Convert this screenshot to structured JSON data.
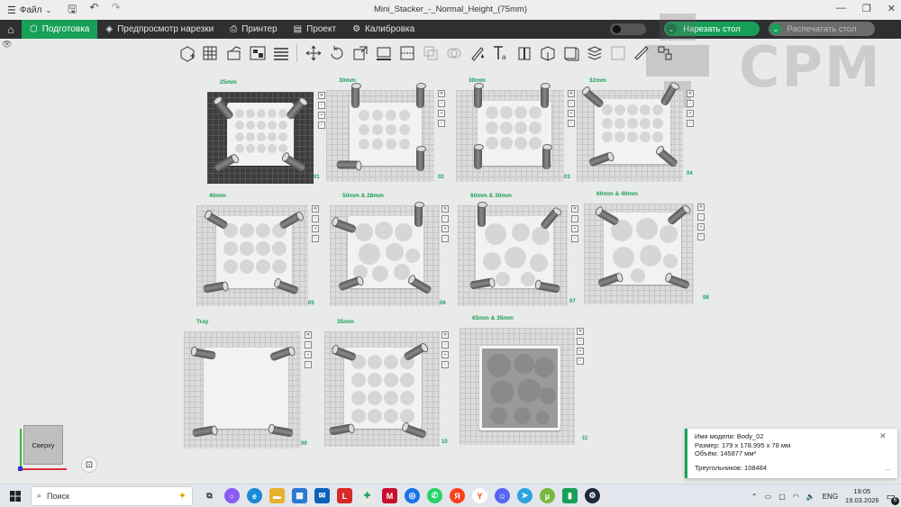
{
  "titlebar": {
    "menu_label": "Файл",
    "menu_icon": "hamburger-icon",
    "window_title": "Mini_Stacker_-_Normal_Height_(75mm)"
  },
  "tabs": [
    {
      "label": "Подготовка",
      "icon": "cube-icon",
      "active": true
    },
    {
      "label": "Предпросмотр нарезки",
      "icon": "layers-icon",
      "active": false
    },
    {
      "label": "Принтер",
      "icon": "printer-icon",
      "active": false
    },
    {
      "label": "Проект",
      "icon": "document-icon",
      "active": false
    },
    {
      "label": "Калибровка",
      "icon": "calibration-icon",
      "active": false
    }
  ],
  "actions": {
    "slice_label": "Нарезать стол",
    "print_label": "Распечатать стол"
  },
  "accent_color": "#18a058",
  "watermark": {
    "text": "CPM"
  },
  "plates": [
    {
      "title": "25mm",
      "num": "01",
      "selected": true
    },
    {
      "title": "30mm",
      "num": "02"
    },
    {
      "title": "30mm",
      "num": "03"
    },
    {
      "title": "32mm",
      "num": "04"
    },
    {
      "title": "40mm",
      "num": "05"
    },
    {
      "title": "50mm & 28mm",
      "num": "06"
    },
    {
      "title": "60mm & 30mm",
      "num": "07"
    },
    {
      "title": "60mm & 40mm",
      "num": "08"
    },
    {
      "title": "Tray",
      "num": "09"
    },
    {
      "title": "35mm",
      "num": "10"
    },
    {
      "title": "65mm & 35mm",
      "num": "11"
    }
  ],
  "viewcube": {
    "label": "Сверху"
  },
  "info_panel": {
    "model_name": "Имя модели: Body_02",
    "size": "Размер: 179 x 178.995 x 78 мм",
    "volume": "Объём: 145877 мм³",
    "triangles": "Треугольников: 108484"
  },
  "taskbar": {
    "search_placeholder": "Поиск",
    "language": "ENG",
    "time": "19:05",
    "date": "19.03.2026",
    "notification_count": "6"
  }
}
